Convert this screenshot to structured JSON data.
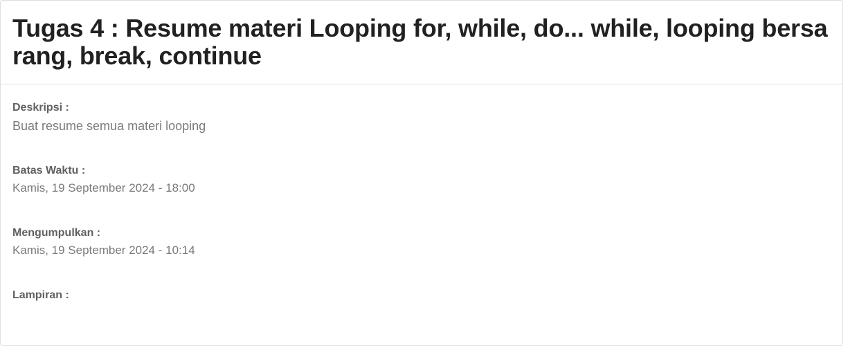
{
  "assignment": {
    "title": "Tugas 4 : Resume materi Looping for, while, do... while, looping bersarang, break, continue"
  },
  "fields": {
    "description": {
      "label": "Deskripsi :",
      "value": "Buat resume semua materi looping"
    },
    "deadline": {
      "label": "Batas Waktu :",
      "value": "Kamis, 19 September 2024 - 18:00"
    },
    "submitted": {
      "label": "Mengumpulkan :",
      "value": "Kamis, 19 September 2024 - 10:14"
    },
    "attachment": {
      "label": "Lampiran :"
    }
  },
  "colors": {
    "title": "#212121",
    "label": "#616161",
    "value": "#7a7a7a",
    "border": "#dddddd"
  }
}
